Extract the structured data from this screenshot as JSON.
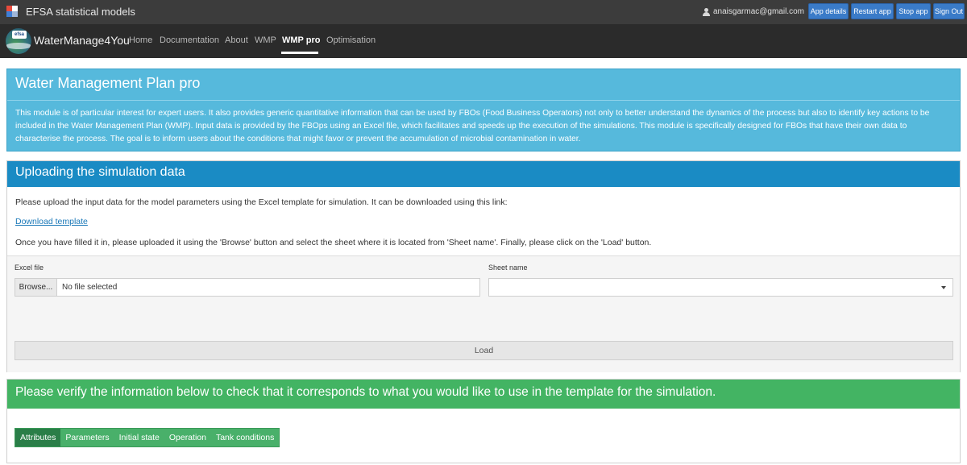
{
  "topbar": {
    "app_title": "EFSA statistical models",
    "user_email": "anaisgarmac@gmail.com",
    "buttons": [
      "App details",
      "Restart app",
      "Stop app",
      "Sign Out"
    ],
    "logo_colors": [
      "#e84b3c",
      "#3f7fd6",
      "#9fb6d8",
      "#ffffff"
    ]
  },
  "navbar": {
    "brand": "WaterManage4You",
    "brand_logo_text": "efsa",
    "items": [
      "Home",
      "Documentation",
      "About",
      "WMP",
      "WMP pro",
      "Optimisation"
    ],
    "active": "WMP pro"
  },
  "intro": {
    "title": "Water Management Plan pro",
    "text": "This module is of particular interest for expert users. It also provides generic quantitative information that can be used by FBOs (Food Business Operators) not only to better understand the dynamics of the process but also to identify key actions to be included in the Water Management Plan (WMP). Input data is provided by the FBOps using an Excel file, which facilitates and speeds up the execution of the simulations. This module is specifically designed for FBOs that have their own data to characterise the process. The goal is to inform users about the conditions that might favor or prevent the accumulation of microbial contamination in water."
  },
  "upload": {
    "title": "Uploading the simulation data",
    "instructions": "Please upload the input data for the model parameters using the Excel template for simulation. It can be downloaded using this link:",
    "download_link": "Download template",
    "instructions2": "Once you have filled it in, please uploaded it using the 'Browse' button and select the sheet where it is located from 'Sheet name'. Finally, please click on the 'Load' button.",
    "excel_label": "Excel file",
    "browse_label": "Browse...",
    "file_placeholder": "No file selected",
    "sheet_label": "Sheet name",
    "load_label": "Load"
  },
  "verify": {
    "title": "Please verify the information below to check that it corresponds to what you would like to use in the template for the simulation.",
    "tabs": [
      "Attributes",
      "Parameters",
      "Initial state",
      "Operation",
      "Tank conditions"
    ],
    "active_tab": "Attributes"
  },
  "colors": {
    "intro_panel": "#56b9dc",
    "upload_header": "#1a8bc4",
    "verify_header": "#43b463",
    "button_blue": "#3a7bc8"
  }
}
